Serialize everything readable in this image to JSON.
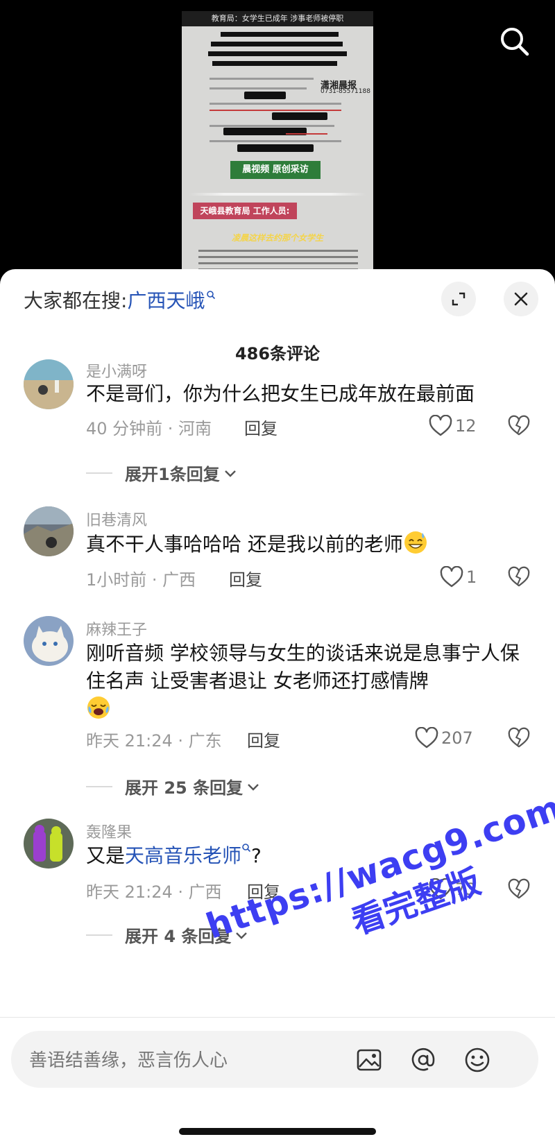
{
  "video": {
    "frame_title": "教育局：女学生已成年 涉事老师被停职",
    "logo": "潇湘晨报",
    "phone": "0731-85571188",
    "green_badge": "晨视频 原创采访",
    "pink_label": "天峨县教育局 工作人员:",
    "yellow_caption": "凌晨这样去约那个女学生",
    "top_search_icon": "search-icon"
  },
  "sheet": {
    "search_prefix": "大家都在搜:",
    "search_term": "广西天峨",
    "expand_icon": "expand-icon",
    "close_icon": "close-icon",
    "comment_count": "486条评论"
  },
  "comments": [
    {
      "name": "是小满呀",
      "text": "不是哥们，你为什么把女生已成年放在最前面",
      "time_loc": "40 分钟前 · 河南",
      "reply": "回复",
      "likes": "12",
      "expand": "展开1条回复"
    },
    {
      "name": "旧巷清风",
      "text": "真不干人事哈哈哈   还是我以前的老师",
      "time_loc": "1小时前 · 广西",
      "reply": "回复",
      "likes": "1"
    },
    {
      "name": "麻辣王子",
      "text": "刚听音频   学校领导与女生的谈话来说是息事宁人保住名声 让受害者退让 女老师还打感情牌",
      "time_loc": "昨天 21:24 · 广东",
      "reply": "回复",
      "likes": "207",
      "expand": "展开 25 条回复"
    },
    {
      "name": "轰隆果",
      "text_prefix": "又是",
      "text_link": "天高音乐老师",
      "text_suffix": "?",
      "time_loc": "昨天 21:24 · 广西",
      "reply": "回复",
      "likes": "73",
      "expand": "展开 4 条回复"
    }
  ],
  "watermark": {
    "url": "https://wacg9.com",
    "sub": "看完整版"
  },
  "input": {
    "placeholder": "善语结善缘，恶言伤人心",
    "icons": [
      "image-icon",
      "at-icon",
      "emoji-icon"
    ]
  },
  "colors": {
    "link": "#2553b6",
    "watermark": "#3d3ef2",
    "meta": "#9a9a9a"
  }
}
